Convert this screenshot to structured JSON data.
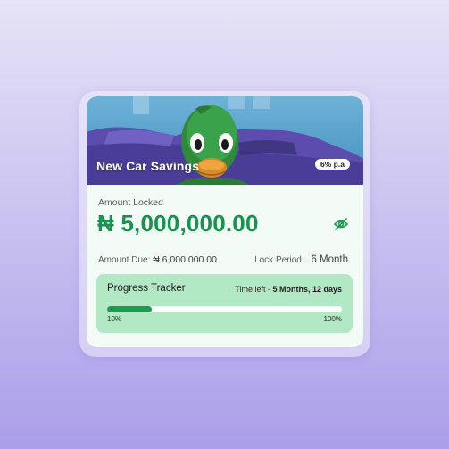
{
  "card": {
    "title": "New Car Savings",
    "rate_badge": "6% p.a",
    "amount_label": "Amount Locked",
    "amount_value": "₦ 5,000,000.00",
    "amount_due_label": "Amount Due:",
    "amount_due_value": "₦ 6,000,000.00",
    "lock_period_label": "Lock Period:",
    "lock_period_value": "6 Month",
    "visibility_icon": "eye-off-icon"
  },
  "tracker": {
    "title": "Progress Tracker",
    "time_left_label": "Time left - ",
    "time_left_value": "5 Months, 12 days",
    "progress": 0.19,
    "start_label": "10%",
    "end_label": "100%"
  },
  "colors": {
    "accent_green": "#14944c",
    "tracker_bg": "#b2e8c3",
    "card_bg": "#f2fbf5",
    "bar_fill": "#1e9a53"
  }
}
